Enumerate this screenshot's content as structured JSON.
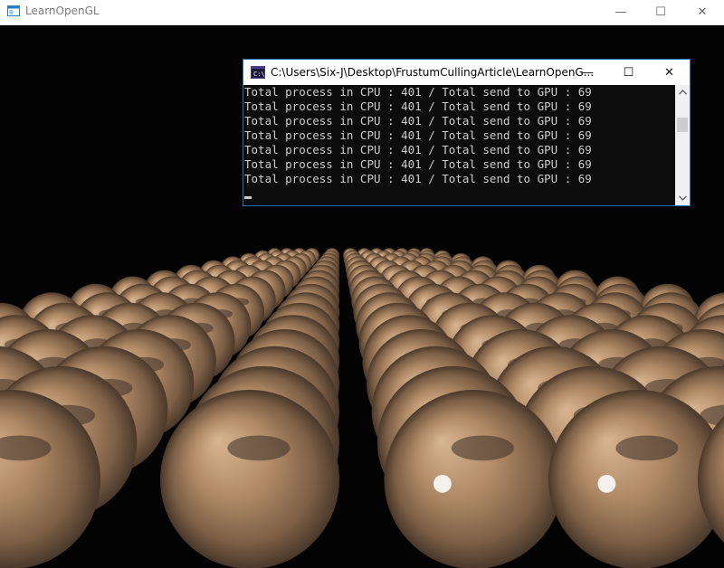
{
  "window": {
    "title": "LearnOpenGL",
    "minimize_glyph": "—",
    "maximize_glyph": "☐",
    "close_glyph": "✕"
  },
  "console": {
    "title": "C:\\Users\\Six-J\\Desktop\\FrustumCullingArticle\\LearnOpenG...",
    "lines": [
      "Total process in CPU : 401 / Total send to GPU : 69",
      "Total process in CPU : 401 / Total send to GPU : 69",
      "Total process in CPU : 401 / Total send to GPU : 69",
      "Total process in CPU : 401 / Total send to GPU : 69",
      "Total process in CPU : 401 / Total send to GPU : 69",
      "Total process in CPU : 401 / Total send to GPU : 69",
      "Total process in CPU : 401 / Total send to GPU : 69"
    ],
    "minimize_glyph": "—",
    "maximize_glyph": "☐",
    "close_glyph": "✕"
  },
  "colors": {
    "planet_base": "#b08a66",
    "planet_dark": "#3a2e27",
    "background": "#030303",
    "console_text": "#cccccc",
    "console_border": "#2c6fb5"
  },
  "icons": {
    "app": "opengl-window-icon",
    "console": "cmd-icon"
  }
}
